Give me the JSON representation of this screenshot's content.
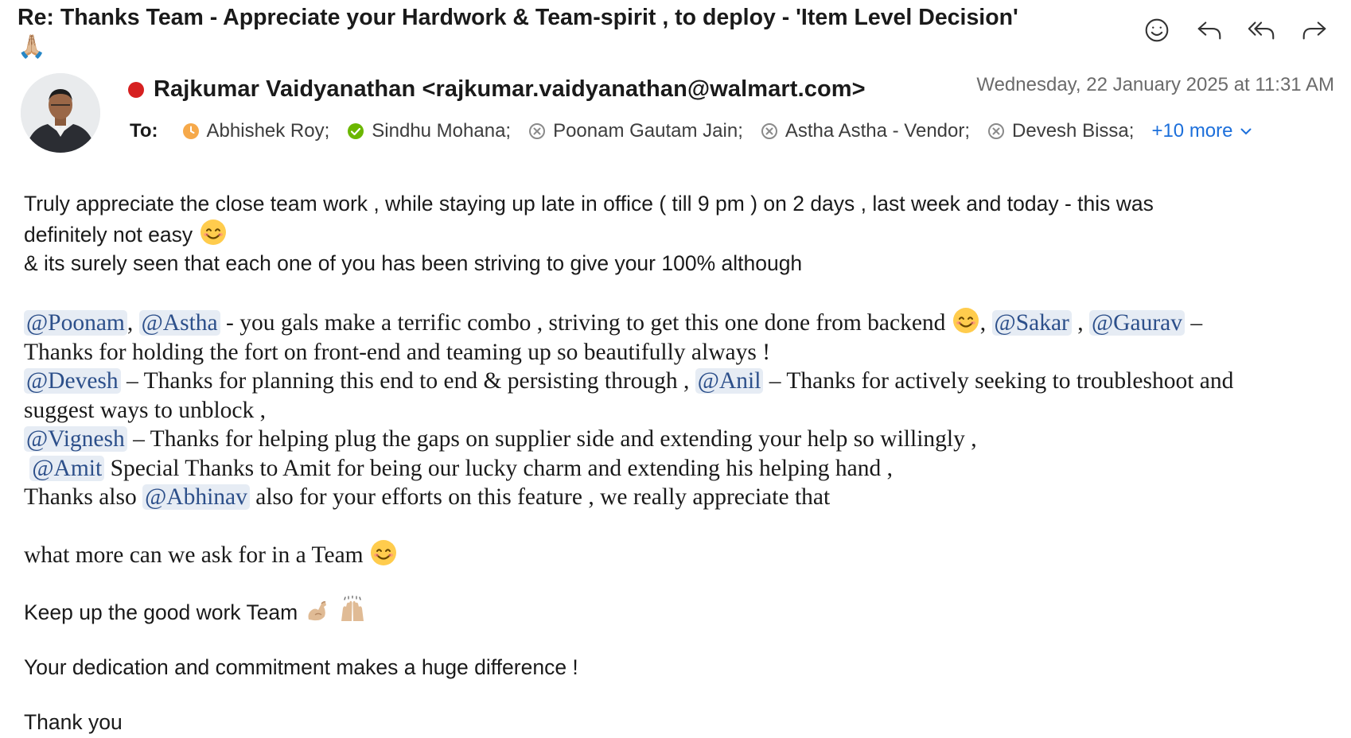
{
  "email": {
    "subject": "Re: Thanks Team - Appreciate your Hardwork & Team-spirit , to deploy - 'Item Level Decision'",
    "subject_emoji": "🙏🏼",
    "sender": "Rajkumar Vaidyanathan <rajkumar.vaidyanathan@walmart.com>",
    "date": "Wednesday, 22 January 2025 at 11:31 AM",
    "to_label": "To:",
    "recipients": [
      {
        "name": "Abhishek Roy;",
        "status": "away"
      },
      {
        "name": "Sindhu Mohana;",
        "status": "available"
      },
      {
        "name": "Poonam Gautam Jain;",
        "status": "offline"
      },
      {
        "name": "Astha Astha - Vendor;",
        "status": "offline"
      },
      {
        "name": "Devesh Bissa;",
        "status": "offline"
      }
    ],
    "more_recipients": "+10 more"
  },
  "toolbar": {
    "icons": [
      "emoji-reaction-icon",
      "reply-icon",
      "reply-all-icon",
      "forward-icon"
    ]
  },
  "colors": {
    "presence_busy": "#d62020",
    "available": "#6bb700",
    "away": "#f6a94a",
    "link": "#1c6fdb",
    "mention_bg": "#e6ecf4",
    "mention_text": "#2c4f8a"
  },
  "body": {
    "p1_l1": "Truly appreciate the close team work , while staying up late in office ( till 9 pm ) on 2 days , last week and today  - this was",
    "p1_l2": "definitely not easy",
    "p1_l3": "& its surely seen that each one of you has been striving to give your 100% although",
    "m_poonam": "@Poonam",
    "comma": ",",
    "m_astha": "@Astha",
    "t_gals": " - you gals make a terrific combo , striving to get this one done from backend",
    "comma2": ",",
    "m_sakar": "@Sakar",
    "sep_comma": ",",
    "m_gaurav": "@Gaurav",
    "t_dash": "–",
    "t_frontend": "Thanks for holding the fort on front-end and teaming up so beautifully always !",
    "m_devesh": "@Devesh",
    "t_devesh": " – Thanks for planning this end to end & persisting through ,",
    "m_anil": "@Anil",
    "t_anil": " – Thanks for actively seeking to troubleshoot and",
    "t_unblock": "suggest ways to unblock ,",
    "m_vignesh": "@Vignesh",
    "t_vignesh": " – Thanks for helping plug the gaps on supplier side and extending your help so willingly ,",
    "m_amit": "@Amit",
    "t_amit": " Special Thanks to Amit for being our lucky charm and extending his helping hand ,",
    "t_also": "Thanks also ",
    "m_abhinav": "@Abhinav",
    "t_abhinav": " also for your efforts on this feature , we really appreciate that",
    "t_ask": "what more can we ask for in a Team",
    "t_keep": "Keep up the good work Team",
    "t_dedication": "Your dedication and commitment makes a huge difference !",
    "t_thanks": "Thank you"
  }
}
